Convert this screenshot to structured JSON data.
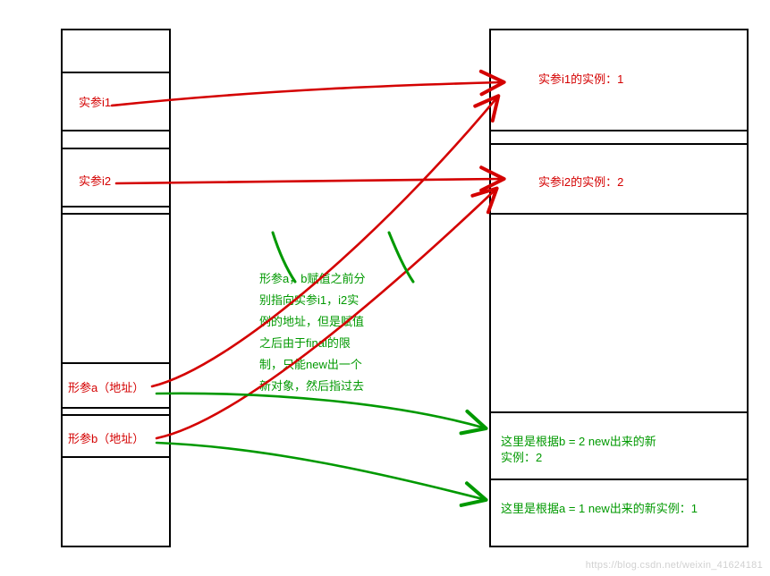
{
  "left_column": {
    "cell1": "实参i1",
    "cell2": "实参i2",
    "cell5": "形参a（地址）",
    "cell6": "形参b（地址）"
  },
  "right_column": {
    "cell1": "实参i1的实例：1",
    "cell2": "实参i2的实例：2",
    "cell5": "这里是根据b = 2 new出来的新\n实例：2",
    "cell6": "这里是根据a = 1 new出来的新实例：1"
  },
  "middle_note": "形参a，b赋值之前分\n别指向实参i1，i2实\n例的地址，但是赋值\n之后由于final的限\n制，只能new出一个\n新对象，然后指过去",
  "watermark": "https://blog.csdn.net/weixin_41624181"
}
